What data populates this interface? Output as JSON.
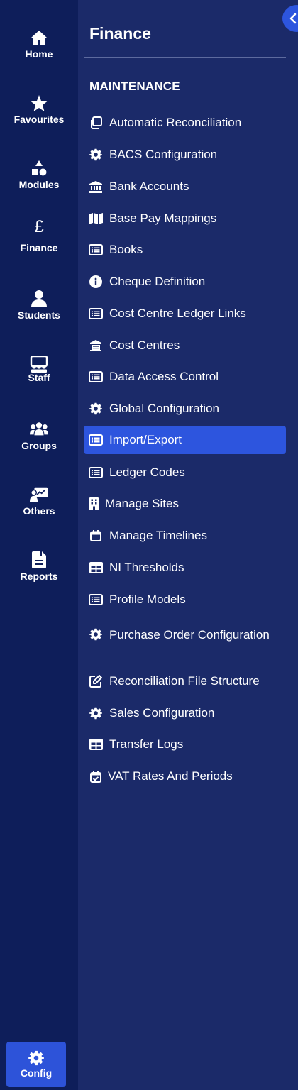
{
  "rail": {
    "items": [
      {
        "label": "Home",
        "icon": "home-icon"
      },
      {
        "label": "Favourites",
        "icon": "star-icon"
      },
      {
        "label": "Modules",
        "icon": "shapes-icon"
      },
      {
        "label": "Finance",
        "icon": "pound-icon",
        "glyph": "£"
      },
      {
        "label": "Students",
        "icon": "user-icon"
      },
      {
        "label": "Staff",
        "icon": "staff-icon"
      },
      {
        "label": "Groups",
        "icon": "users-icon"
      },
      {
        "label": "Others",
        "icon": "presentation-icon"
      },
      {
        "label": "Reports",
        "icon": "file-icon"
      }
    ],
    "config_label": "Config"
  },
  "panel": {
    "title": "Finance",
    "section": "MAINTENANCE",
    "items": [
      {
        "label": "Automatic Reconciliation",
        "icon": "copy-icon"
      },
      {
        "label": "BACS Configuration",
        "icon": "gear-icon"
      },
      {
        "label": "Bank Accounts",
        "icon": "bank-icon"
      },
      {
        "label": "Base Pay Mappings",
        "icon": "map-icon"
      },
      {
        "label": "Books",
        "icon": "list-icon"
      },
      {
        "label": "Cheque Definition",
        "icon": "info-icon"
      },
      {
        "label": "Cost Centre Ledger Links",
        "icon": "list-icon"
      },
      {
        "label": "Cost Centres",
        "icon": "building-icon"
      },
      {
        "label": "Data Access Control",
        "icon": "list-icon"
      },
      {
        "label": "Global Configuration",
        "icon": "gear-icon"
      },
      {
        "label": "Import/Export",
        "icon": "list-icon",
        "active": true
      },
      {
        "label": "Ledger Codes",
        "icon": "list-icon"
      },
      {
        "label": "Manage Sites",
        "icon": "office-icon"
      },
      {
        "label": "Manage Timelines",
        "icon": "calendar-icon"
      },
      {
        "label": "NI Thresholds",
        "icon": "table-icon"
      },
      {
        "label": "Profile Models",
        "icon": "list-icon"
      },
      {
        "label": "Purchase Order Configuration",
        "icon": "gear-icon"
      },
      {
        "label": "Reconciliation File Structure",
        "icon": "edit-icon"
      },
      {
        "label": "Sales Configuration",
        "icon": "gear-icon"
      },
      {
        "label": "Transfer Logs",
        "icon": "table-icon"
      },
      {
        "label": "VAT Rates And Periods",
        "icon": "calendar-check-icon"
      }
    ]
  },
  "colors": {
    "rail_bg": "#0e1e5a",
    "panel_bg": "#1b2a69",
    "accent": "#2d55de"
  }
}
